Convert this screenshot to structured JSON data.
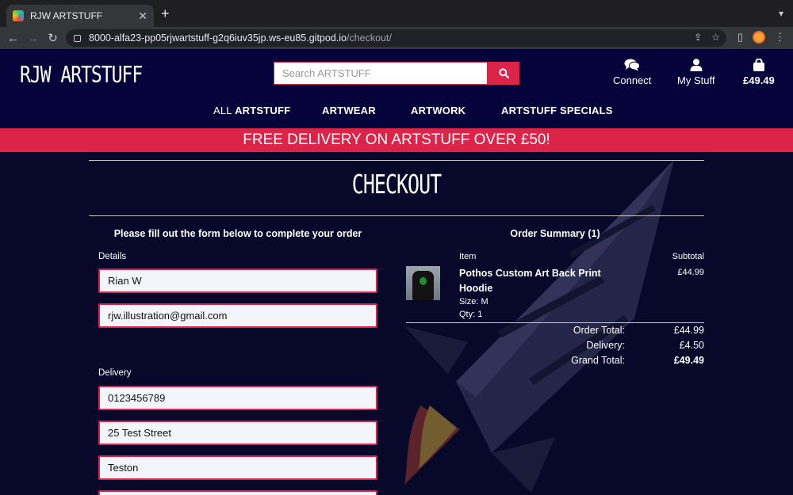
{
  "browser": {
    "tab_title": "RJW ARTSTUFF",
    "tab_close": "✕",
    "new_tab": "+",
    "url_host": "8000-alfa23-pp05rjwartstuff-g2q6iuv35jp.ws-eu85.gitpod.io",
    "url_path": "/checkout/"
  },
  "header": {
    "logo": "RJW ARTSTUFF",
    "search_placeholder": "Search ARTSTUFF",
    "connect_label": "Connect",
    "mystuff_label": "My Stuff",
    "bag_total": "£49.49"
  },
  "nav": {
    "all_prefix": "ALL",
    "all_word": "ARTSTUFF",
    "artwear": "ARTWEAR",
    "artwork": "ARTWORK",
    "specials": "ARTSTUFF SPECIALS"
  },
  "banner": "FREE DELIVERY ON ARTSTUFF OVER £50!",
  "page": {
    "title": "CHECKOUT",
    "form_heading": "Please fill out the form below to complete your order",
    "details_label": "Details",
    "delivery_label": "Delivery",
    "fields": {
      "full_name": "Rian W",
      "email": "rjw.illustration@gmail.com",
      "phone": "0123456789",
      "street": "25 Test Street",
      "town": "Teston"
    }
  },
  "summary": {
    "heading": "Order Summary (1)",
    "col_item": "Item",
    "col_subtotal": "Subtotal",
    "product_name": "Pothos Custom Art Back Print Hoodie",
    "size": "Size: M",
    "qty": "Qty: 1",
    "product_subtotal": "£44.99",
    "order_total_label": "Order Total:",
    "order_total": "£44.99",
    "delivery_label": "Delivery:",
    "delivery": "£4.50",
    "grand_total_label": "Grand Total:",
    "grand_total": "£49.49"
  },
  "colors": {
    "accent": "#dc2449",
    "header_bg": "#04043a",
    "page_bg": "#07082a"
  }
}
